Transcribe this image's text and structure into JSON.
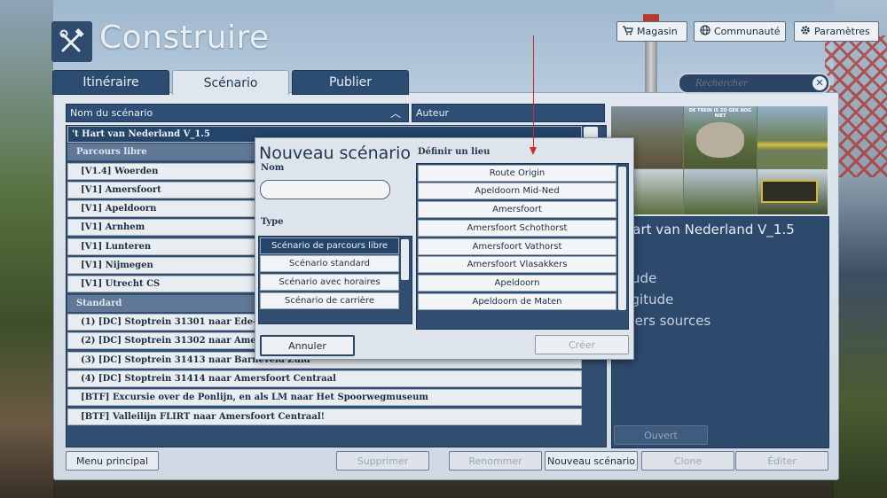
{
  "app": {
    "title": "Construire"
  },
  "top_buttons": {
    "store": "Magasin",
    "community": "Communauté",
    "settings": "Paramètres"
  },
  "tabs": [
    {
      "label": "Itinéraire",
      "active": false
    },
    {
      "label": "Scénario",
      "active": true
    },
    {
      "label": "Publier",
      "active": false
    }
  ],
  "search": {
    "placeholder": "Rechercher"
  },
  "columns": {
    "name": "Nom du scénario",
    "author": "Auteur"
  },
  "scenario_list": {
    "route_name": "'t Hart van Nederland V_1.5",
    "groups": [
      {
        "label": "Parcours libre",
        "items": [
          "[V1.4] Woerden",
          "[V1] Amersfoort",
          "[V1] Apeldoorn",
          "[V1] Arnhem",
          "[V1] Lunteren",
          "[V1] Nijmegen",
          "[V1] Utrecht CS"
        ]
      },
      {
        "label": "Standard",
        "items": [
          "(1) [DC] Stoptrein 31301 naar Ede-Wageningen",
          "(2) [DC] Stoptrein 31302 naar Amersfoort Centraal",
          "(3) [DC] Stoptrein 31413 naar Barneveld Zuid",
          "(4) [DC] Stoptrein 31414 naar Amersfoort Centraal",
          "[BTF] Excursie over de Ponlijn, en als LM naar Het Spoorwegmuseum",
          "[BTF] Valleilijn FLIRT naar Amersfoort Centraal!"
        ]
      }
    ]
  },
  "info_panel": {
    "title": "Hart van Nederland V_1.5",
    "lines": [
      "itude",
      "ngitude",
      "hiers sources"
    ],
    "open_button": "Ouvert"
  },
  "bottom_buttons": {
    "main_menu": "Menu principal",
    "delete": "Supprimer",
    "rename": "Renommer",
    "new_scenario": "Nouveau scénario",
    "clone": "Clone",
    "edit": "Éditer"
  },
  "dialog": {
    "title": "Nouveau scénario",
    "name_label": "Nom",
    "name_value": "",
    "type_label": "Type",
    "types": [
      {
        "label": "Scénario de parcours libre",
        "selected": true
      },
      {
        "label": "Scénario standard",
        "selected": false
      },
      {
        "label": "Scénario avec horaires",
        "selected": false
      },
      {
        "label": "Scénario de carrière",
        "selected": false
      }
    ],
    "location_label": "Définir un lieu",
    "locations": [
      "Route Origin",
      "Apeldoorn Mid-Ned",
      "Amersfoort",
      "Amersfoort Schothorst",
      "Amersfoort Vathorst",
      "Amersfoort Vlasakkers",
      "Apeldoorn",
      "Apeldoorn de Maten"
    ],
    "cancel": "Annuler",
    "create": "Créer"
  },
  "preview_text": "DE TREIN IS ZO GEK NOG NIET",
  "colors": {
    "accent": "#2f4e74",
    "arrow": "#d12a2a",
    "selected": "#254469"
  },
  "icons": {
    "logo": "tools-icon",
    "store": "cart-icon",
    "community": "globe-icon",
    "settings": "gear-icon"
  }
}
